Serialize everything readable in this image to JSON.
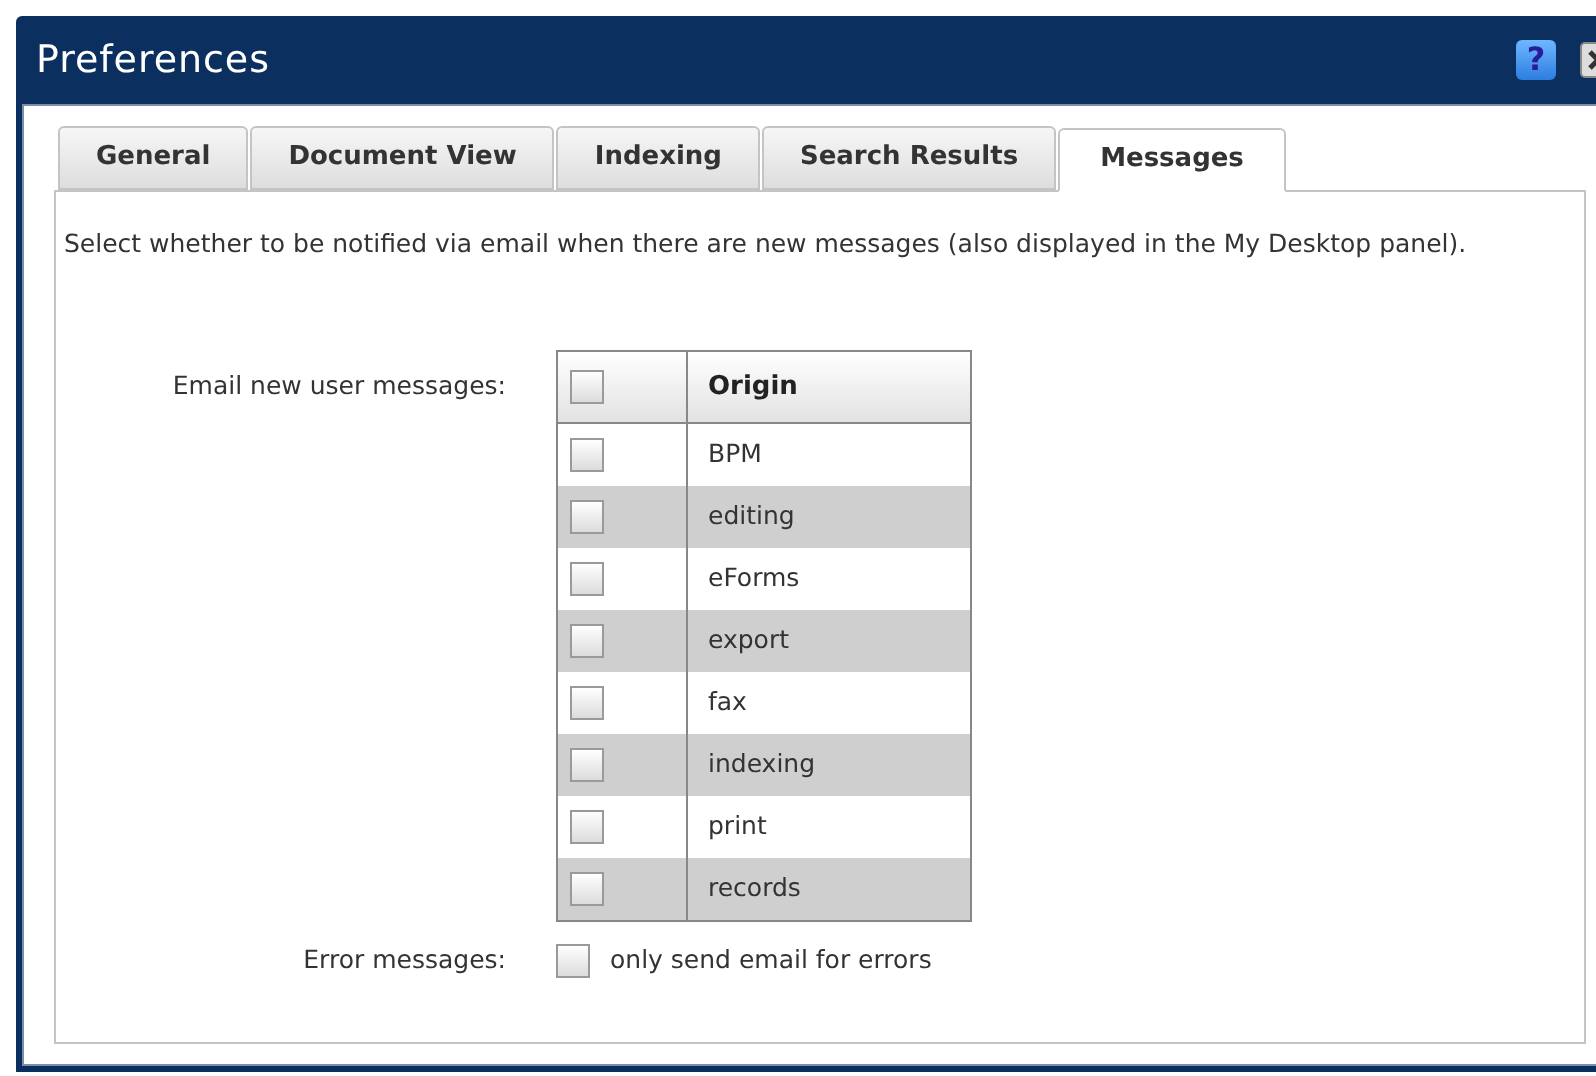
{
  "window": {
    "title": "Preferences",
    "help": "?"
  },
  "tabs": [
    {
      "label": "General",
      "selected": false
    },
    {
      "label": "Document View",
      "selected": false
    },
    {
      "label": "Indexing",
      "selected": false
    },
    {
      "label": "Search Results",
      "selected": false
    },
    {
      "label": "Messages",
      "selected": true
    }
  ],
  "description": "Select whether to be notified via email when there are new messages (also displayed in the My Desktop panel).",
  "email_new_user_messages": {
    "label": "Email new user messages:",
    "header_checked": false,
    "column": "Origin",
    "rows": [
      {
        "origin": "BPM",
        "checked": false
      },
      {
        "origin": "editing",
        "checked": false
      },
      {
        "origin": "eForms",
        "checked": false
      },
      {
        "origin": "export",
        "checked": false
      },
      {
        "origin": "fax",
        "checked": false
      },
      {
        "origin": "indexing",
        "checked": false
      },
      {
        "origin": "print",
        "checked": false
      },
      {
        "origin": "records",
        "checked": false
      }
    ]
  },
  "error_messages": {
    "label": "Error messages:",
    "option": "only send email for errors",
    "checked": false
  }
}
